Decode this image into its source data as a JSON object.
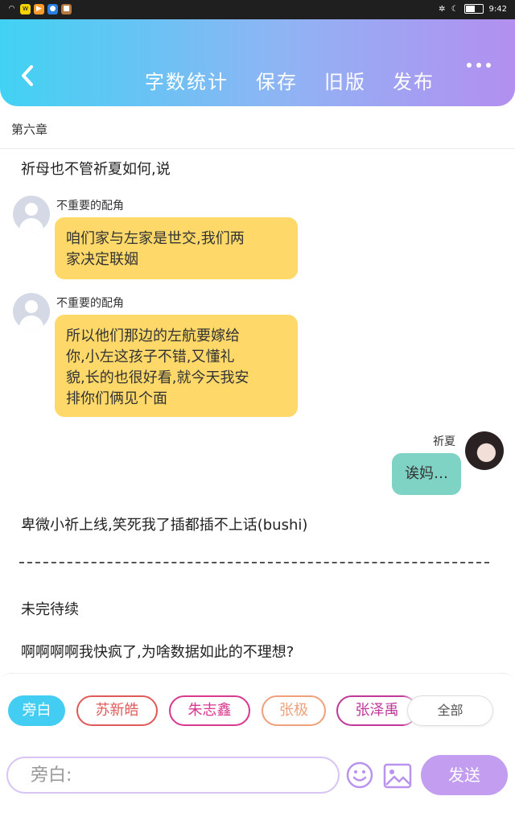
{
  "status_bar": {
    "time": "9:42",
    "battery_level": 0.55
  },
  "header": {
    "nav": [
      "字数统计",
      "保存",
      "旧版",
      "发布"
    ],
    "back_icon": "chevron-left-icon",
    "more_icon": "more-dots-icon"
  },
  "chapter": "第六章",
  "content": {
    "narration_1": "祈母也不管祈夏如何,说",
    "messages": [
      {
        "speaker": "不重要的配角",
        "lines": [
          "咱们家与左家是世交,我们两",
          "家决定联姻"
        ]
      },
      {
        "speaker": "不重要的配角",
        "lines": [
          "所以他们那边的左航要嫁给",
          "你,小左这孩子不错,又懂礼",
          "貌,长的也很好看,就今天我安",
          "排你们俩见个面"
        ]
      },
      {
        "speaker": "祈夏",
        "text": "诶妈…"
      }
    ],
    "narration_2": "卑微小祈上线,笑死我了插都插不上话(bushi)",
    "narration_3": "未完待续",
    "narration_4": "啊啊啊啊我快疯了,为啥数据如此的不理想?"
  },
  "roles": {
    "chips": [
      "旁白",
      "苏新皓",
      "朱志鑫",
      "张极",
      "张泽禹"
    ],
    "all_label": "全部",
    "colors": {
      "selected": "#43cdf3",
      "su": "#e05a5a",
      "zhu": "#d9388f",
      "zhang_ji": "#f0a07a",
      "zhang_ze": "#c0399a"
    }
  },
  "composer": {
    "placeholder": "旁白:",
    "send_label": "发送",
    "emoji_icon": "smiley-icon",
    "image_icon": "image-icon"
  }
}
